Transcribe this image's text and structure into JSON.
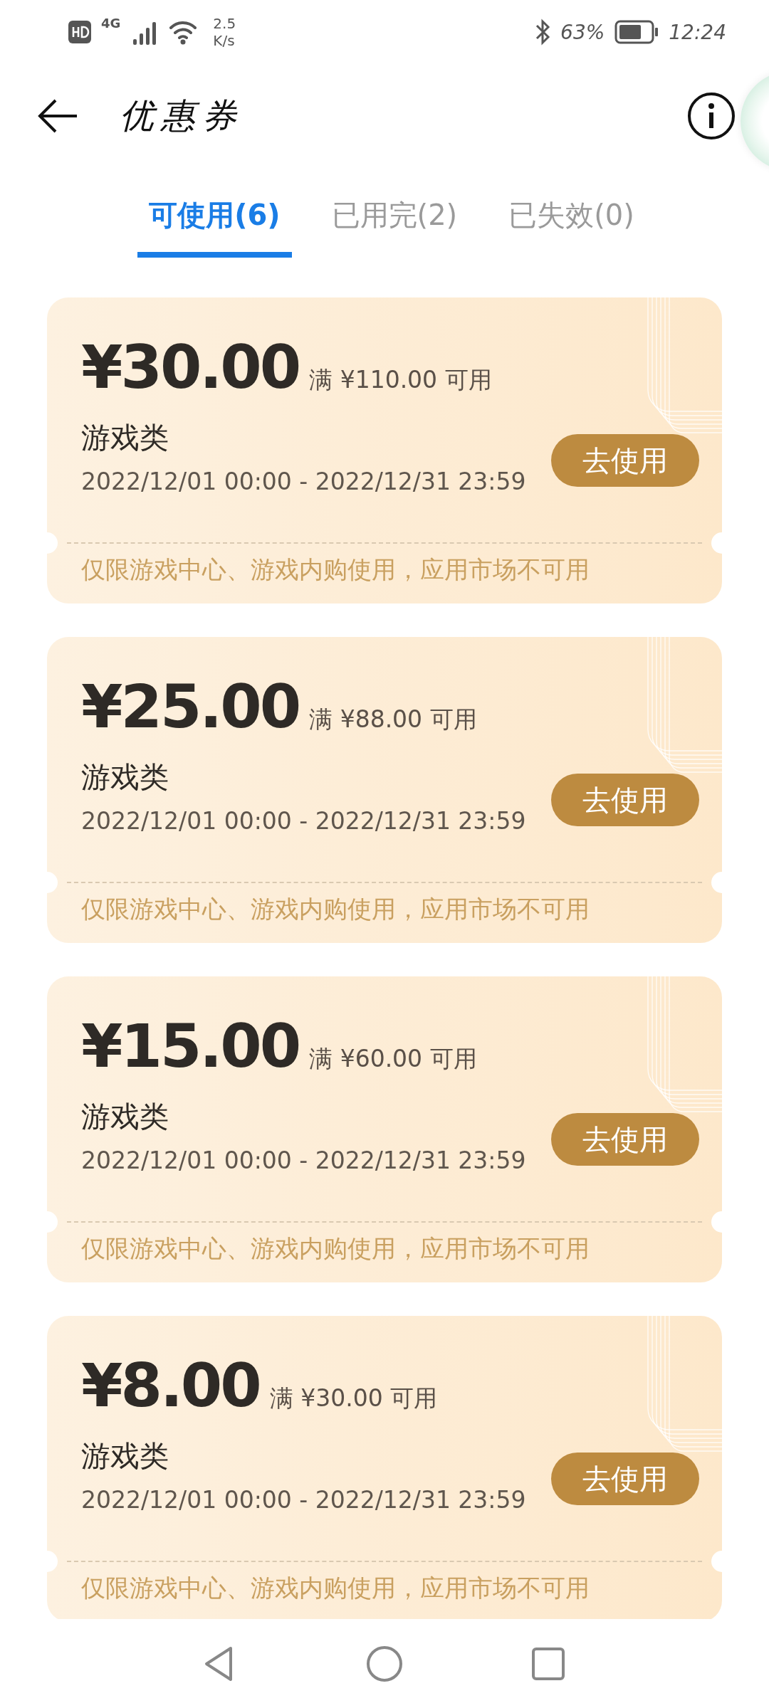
{
  "status_bar": {
    "network": "4G",
    "speed_value": "2.5",
    "speed_unit": "K/s",
    "battery": "63%",
    "time": "12:24"
  },
  "header": {
    "title": "优惠券"
  },
  "tabs": [
    {
      "label": "可使用(6)",
      "selected": true
    },
    {
      "label": "已用完(2)",
      "selected": false
    },
    {
      "label": "已失效(0)",
      "selected": false
    }
  ],
  "coupons": [
    {
      "amount": "¥30.00",
      "condition": "满 ¥110.00 可用",
      "category": "游戏类",
      "validity": "2022/12/01 00:00 - 2022/12/31 23:59",
      "button": "去使用",
      "note": "仅限游戏中心、游戏内购使用，应用市场不可用"
    },
    {
      "amount": "¥25.00",
      "condition": "满 ¥88.00 可用",
      "category": "游戏类",
      "validity": "2022/12/01 00:00 - 2022/12/31 23:59",
      "button": "去使用",
      "note": "仅限游戏中心、游戏内购使用，应用市场不可用"
    },
    {
      "amount": "¥15.00",
      "condition": "满 ¥60.00 可用",
      "category": "游戏类",
      "validity": "2022/12/01 00:00 - 2022/12/31 23:59",
      "button": "去使用",
      "note": "仅限游戏中心、游戏内购使用，应用市场不可用"
    },
    {
      "amount": "¥8.00",
      "condition": "满 ¥30.00 可用",
      "category": "游戏类",
      "validity": "2022/12/01 00:00 - 2022/12/31 23:59",
      "button": "去使用",
      "note": "仅限游戏中心、游戏内购使用，应用市场不可用"
    }
  ]
}
